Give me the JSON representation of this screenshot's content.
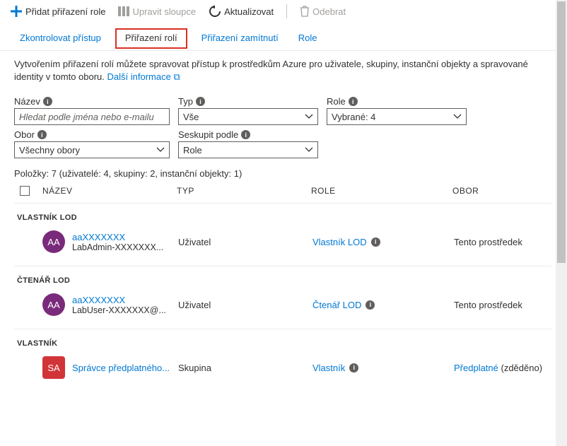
{
  "toolbar": {
    "add": "Přidat přiřazení role",
    "edit_cols": "Upravit sloupce",
    "refresh": "Aktualizovat",
    "remove": "Odebrat"
  },
  "tabs": {
    "check": "Zkontrolovat přístup",
    "roles": "Přiřazení rolí",
    "deny": "Přiřazení zamítnutí",
    "role": "Role"
  },
  "desc1": "Vytvořením přiřazení rolí můžete spravovat přístup k prostředkům Azure pro uživatele, skupiny, instanční objekty a spravované identity v tomto oboru.",
  "learn": "Další informace",
  "filters": {
    "name_lbl": "Název",
    "name_ph": "Hledat podle jména nebo e-mailu",
    "type_lbl": "Typ",
    "type_val": "Vše",
    "role_lbl": "Role",
    "role_val": "Vybrané: 4",
    "scope_lbl": "Obor",
    "scope_val": "Všechny obory",
    "group_lbl": "Seskupit podle",
    "group_val": "Role"
  },
  "summary": "Položky: 7 (uživatelé: 4, skupiny: 2, instanční objekty: 1)",
  "headers": {
    "name": "NÁZEV",
    "type": "TYP",
    "role": "ROLE",
    "scope": "OBOR"
  },
  "groups": [
    {
      "title": "VLASTNÍK LOD",
      "rows": [
        {
          "avatar": "AA",
          "color": "purple",
          "name": "aaXXXXXXX",
          "sub": "LabAdmin-XXXXXXX...",
          "type": "Uživatel",
          "role": "Vlastník LOD",
          "info": true,
          "scope": "Tento prostředek",
          "scope_link": false,
          "inherited": ""
        }
      ]
    },
    {
      "title": "ČTENÁŘ LOD",
      "rows": [
        {
          "avatar": "AA",
          "color": "purple",
          "name": "aaXXXXXXX",
          "sub": "LabUser-XXXXXXX@...",
          "type": "Uživatel",
          "role": "Čtenář LOD",
          "info": true,
          "scope": "Tento prostředek",
          "scope_link": false,
          "inherited": ""
        }
      ]
    },
    {
      "title": "VLASTNÍK",
      "rows": [
        {
          "avatar": "SA",
          "color": "red",
          "name": "Správce předplatného...",
          "sub": "",
          "type": "Skupina",
          "role": "Vlastník",
          "info": true,
          "scope": "Předplatné",
          "scope_link": true,
          "inherited": " (zděděno)"
        }
      ]
    }
  ]
}
